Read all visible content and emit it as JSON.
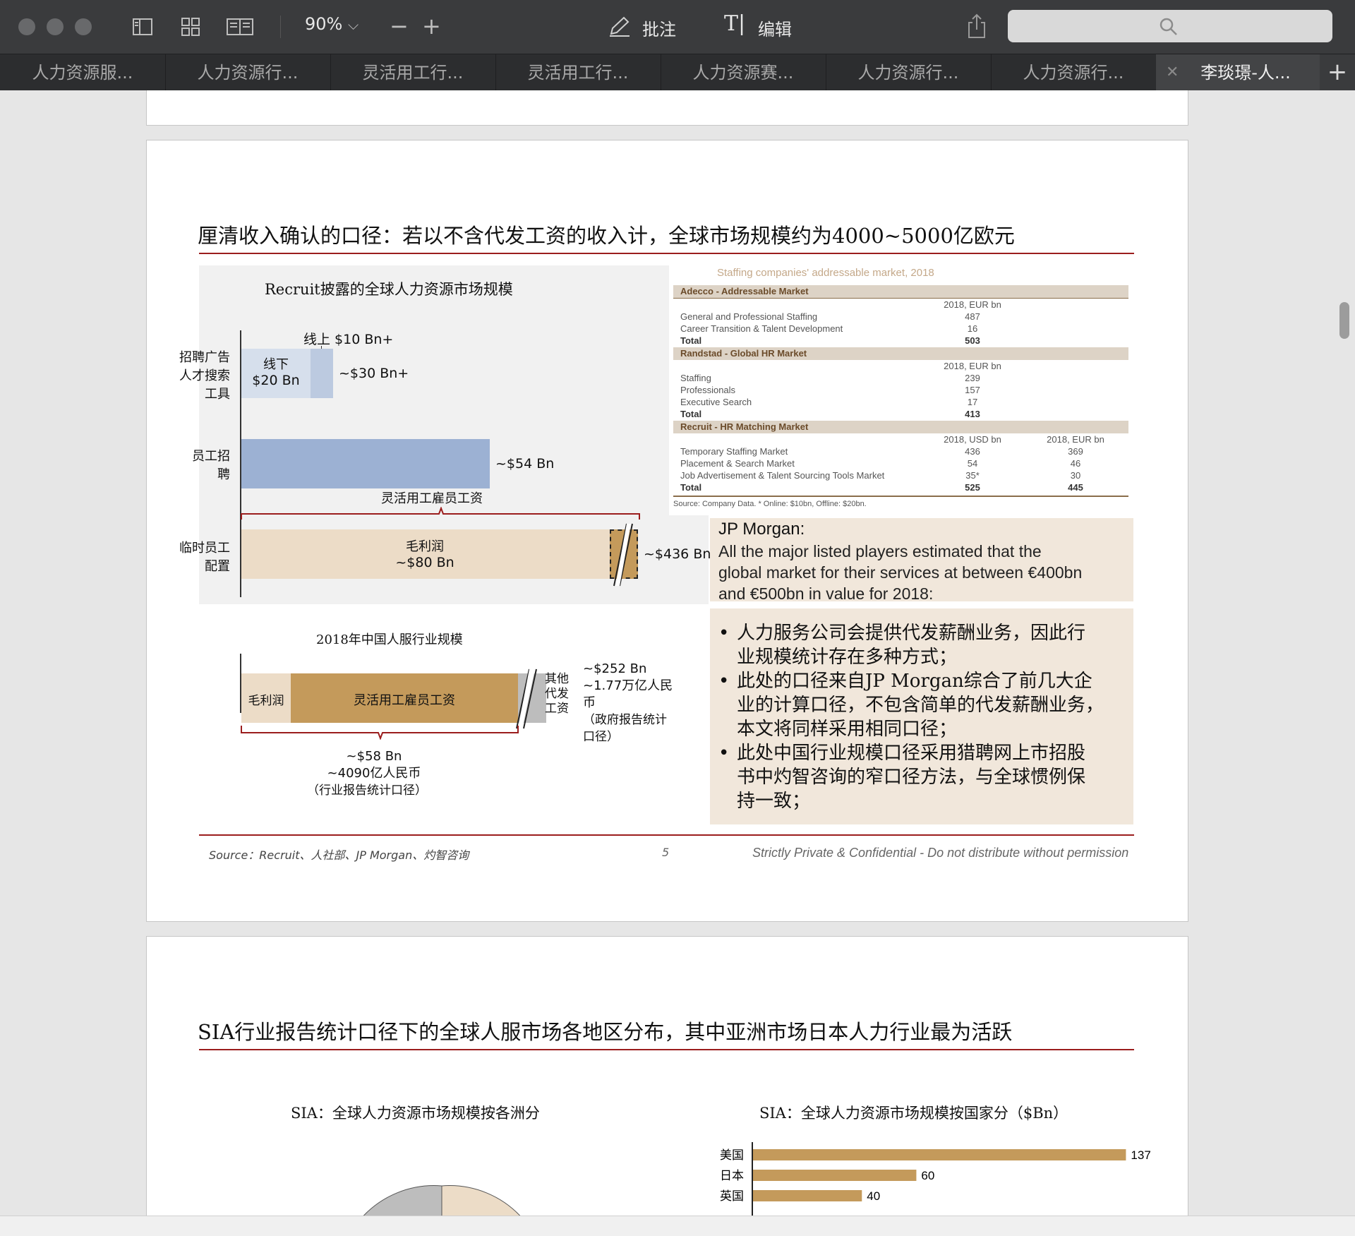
{
  "toolbar": {
    "zoom": "90%",
    "annotate": "批注",
    "edit": "编辑"
  },
  "tabs": [
    "人力资源服...",
    "人力资源行...",
    "灵活用工行...",
    "灵活用工行...",
    "人力资源赛...",
    "人力资源行...",
    "人力资源行...",
    "李琰璟-人..."
  ],
  "slide5": {
    "title": "厘清收入确认的口径：若以不含代发工资的收入计，全球市场规模约为4000~5000亿欧元",
    "recruit_chart": {
      "title": "Recruit披露的全球人力资源市场规模",
      "row1_label": [
        "招聘广告",
        "人才搜索",
        "工具"
      ],
      "row2_label": [
        "员工招",
        "聘"
      ],
      "row3_label": [
        "临时员工",
        "配置"
      ],
      "online": "线上 $10 Bn+",
      "offline": [
        "线下",
        "$20 Bn"
      ],
      "total_ads": "~$30 Bn+",
      "placement": "~$54 Bn",
      "flex_wage": "灵活用工雇员工资",
      "gross_profit": [
        "毛利润",
        "~$80 Bn"
      ],
      "temp_total": "~$436 Bn"
    },
    "table": {
      "title": "Staffing companies' addressable market, 2018",
      "adecco_head": "Adecco - Addressable Market",
      "col_eur": "2018, EUR bn",
      "adecco_rows": [
        {
          "label": "General and Professional Staffing",
          "value": "487"
        },
        {
          "label": "Career Transition & Talent Development",
          "value": "16"
        },
        {
          "label": "Total",
          "value": "503"
        }
      ],
      "randstad_head": "Randstad - Global HR Market",
      "randstad_rows": [
        {
          "label": "Staffing",
          "value": "239"
        },
        {
          "label": "Professionals",
          "value": "157"
        },
        {
          "label": "Executive Search",
          "value": "17"
        },
        {
          "label": "Total",
          "value": "413"
        }
      ],
      "recruit_head": "Recruit - HR Matching Market",
      "col_usd": "2018, USD bn",
      "recruit_rows": [
        {
          "label": "Temporary Staffing Market",
          "usd": "436",
          "eur": "369"
        },
        {
          "label": "Placement & Search Market",
          "usd": "54",
          "eur": "46"
        },
        {
          "label": "Job Advertisement & Talent Sourcing Tools Market",
          "usd": "35*",
          "eur": "30"
        },
        {
          "label": "Total",
          "usd": "525",
          "eur": "445"
        }
      ],
      "source": "Source: Company Data. * Online: $10bn, Offline: $20bn."
    },
    "jpm": {
      "heading": "JP Morgan:",
      "lines": [
        "All the major listed players estimated that the",
        "global market for their services at between €400bn",
        "and €500bn in value for 2018:"
      ]
    },
    "china_chart": {
      "title": "2018年中国人服行业规模",
      "gross_profit": "毛利润",
      "flex_wage": "灵活用工雇员工资",
      "other": [
        "其他",
        "代发",
        "工资"
      ],
      "total_usd": "~$252 Bn",
      "total_rmb": [
        "~1.77万亿人民",
        "币"
      ],
      "total_note": [
        "（政府报告统计",
        "口径）"
      ],
      "core_usd": "~$58 Bn",
      "core_rmb": "~4090亿人民币",
      "core_note": "（行业报告统计口径）"
    },
    "bullets": [
      [
        "人力服务公司会提供代发薪酬业务，因此行",
        "业规模统计存在多种方式；"
      ],
      [
        "此处的口径来自JP Morgan综合了前几大企",
        "业的计算口径，不包含简单的代发薪酬业务，",
        "本文将同样采用相同口径；"
      ],
      [
        "此处中国行业规模口径采用猎聘网上市招股",
        "书中灼智咨询的窄口径方法，与全球惯例保",
        "持一致；"
      ]
    ],
    "footer": {
      "source": "Source：Recruit、人社部、JP Morgan、灼智咨询",
      "page": "5",
      "confidential": "Strictly Private & Confidential - Do not distribute without permission"
    }
  },
  "slide6": {
    "title": "SIA行业报告统计口径下的全球人服市场各地区分布，其中亚洲市场日本人力行业最为活跃",
    "pie_title": "SIA：全球人力资源市场规模按各洲分",
    "bar_title": "SIA：全球人力资源市场规模按国家分（$Bn）"
  },
  "chart_data": [
    {
      "type": "bar",
      "title": "SIA：全球人力资源市场规模按国家分（$Bn）",
      "categories": [
        "美国",
        "日本",
        "英国"
      ],
      "values": [
        137,
        60,
        40
      ],
      "xlim": [
        0,
        140
      ]
    }
  ],
  "colors": {
    "accent_red": "#9b1d1d",
    "bar_gold": "#c49a5b",
    "beige": "#ecdcc7",
    "blue": "#9cb1d3",
    "light_blue": "#d6dfec"
  }
}
